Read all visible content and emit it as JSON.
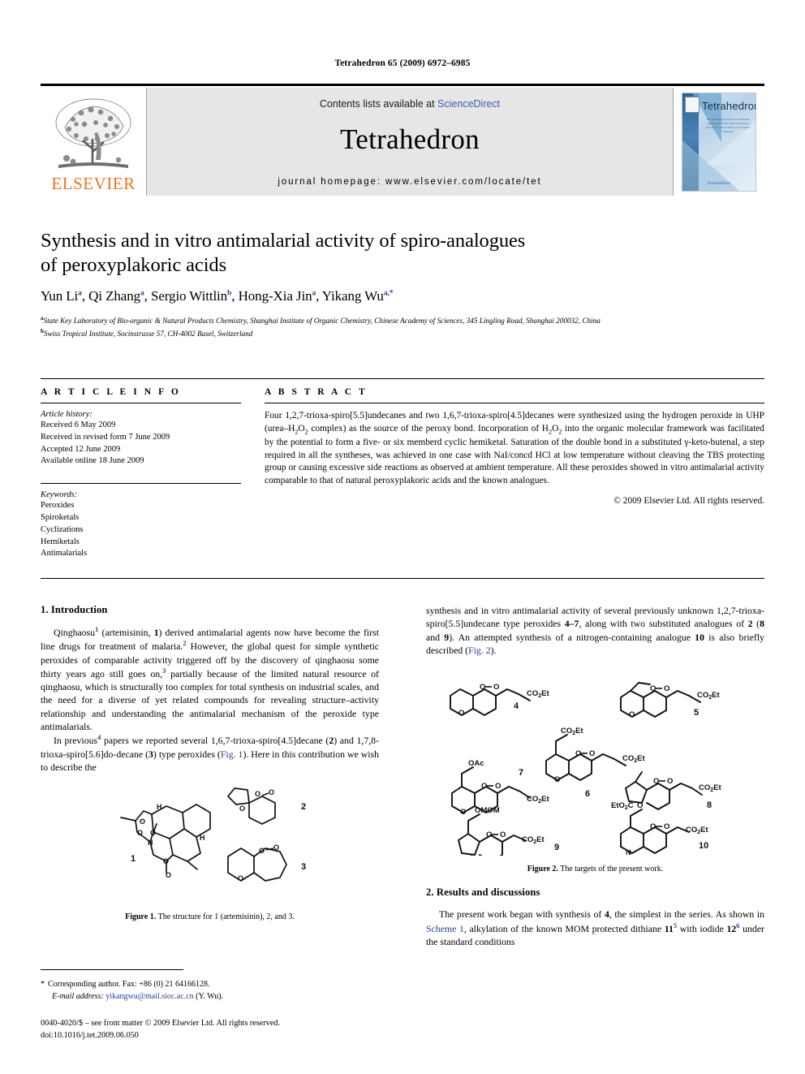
{
  "running_head": "Tetrahedron 65 (2009) 6972–6985",
  "masthead": {
    "contents_prefix": "Contents lists available at ",
    "sciencedirect": "ScienceDirect",
    "journal_name": "Tetrahedron",
    "homepage": "journal homepage: www.elsevier.com/locate/tet",
    "publisher_wordmark": "ELSEVIER",
    "cover_title": "Tetrahedron",
    "cover_subtitle": "The International Journal for the Rapid Publication of Full Original Research Papers and Critical Reviews in Organic Chemistry",
    "cover_footer": "ScienceDirect",
    "accent_orange": "#E87722",
    "link_blue": "#2b3d91",
    "masthead_grey": "#e6e6e6"
  },
  "title": "Synthesis and in vitro antimalarial activity of spiro-analogues of peroxyplakoric acids",
  "title_line1": "Synthesis and in vitro antimalarial activity of spiro-analogues",
  "title_line2": "of peroxyplakoric acids",
  "authors": [
    {
      "name": "Yun Li",
      "sup": "a"
    },
    {
      "name": "Qi Zhang",
      "sup": "a"
    },
    {
      "name": "Sergio Wittlin",
      "sup": "b"
    },
    {
      "name": "Hong-Xia Jin",
      "sup": "a"
    },
    {
      "name": "Yikang Wu",
      "sup": "a,*"
    }
  ],
  "affiliations": [
    {
      "sup": "a",
      "text": "State Key Laboratory of Bio-organic & Natural Products Chemistry, Shanghai Institute of Organic Chemistry, Chinese Academy of Sciences, 345 Lingling Road, Shanghai 200032, China"
    },
    {
      "sup": "b",
      "text": "Swiss Tropical Institute, Socinstrasse 57, CH-4002 Basel, Switzerland"
    }
  ],
  "article_info": {
    "heading": "A R T I C L E  I N F O",
    "history_title": "Article history:",
    "history": [
      "Received 6 May 2009",
      "Received in revised form 7 June 2009",
      "Accepted 12 June 2009",
      "Available online 18 June 2009"
    ],
    "keywords_title": "Keywords:",
    "keywords": [
      "Peroxides",
      "Spiroketals",
      "Cyclizations",
      "Hemiketals",
      "Antimalarials"
    ]
  },
  "abstract": {
    "heading": "A B S T R A C T",
    "text": "Four 1,2,7-trioxa-spiro[5.5]undecanes and two 1,6,7-trioxa-spiro[4.5]decanes were synthesized using the hydrogen peroxide in UHP (urea–H2O2 complex) as the source of the peroxy bond. Incorporation of H2O2 into the organic molecular framework was facilitated by the potential to form a five- or six memberd cyclic hemiketal. Saturation of the double bond in a substituted γ-keto-butenal, a step required in all the syntheses, was achieved in one case with NaI/concd HCl at low temperature without cleaving the TBS protecting group or causing excessive side reactions as observed at ambient temperature. All these peroxides showed in vitro antimalarial activity comparable to that of natural peroxyplakoric acids and the known analogues.",
    "copyright": "© 2009 Elsevier Ltd. All rights reserved."
  },
  "sections": {
    "introduction_heading": "1. Introduction",
    "intro_p1": "Qinghaosu1 (artemisinin, 1) derived antimalarial agents now have become the first line drugs for treatment of malaria.2 However, the global quest for simple synthetic peroxides of comparable activity triggered off by the discovery of qinghaosu some thirty years ago still goes on,3 partially because of the limited natural resource of qinghaosu, which is structurally too complex for total synthesis on industrial scales, and the need for a diverse of yet related compounds for revealing structure–activity relationship and understanding the antimalarial mechanism of the peroxide type antimalarials.",
    "intro_p2": "In previous4 papers we reported several 1,6,7-trioxa-spiro[4.5]decane (2) and 1,7,8-trioxa-spiro[5.6]do-decane (3) type peroxides (Fig. 1). Here in this contribution we wish to describe the synthesis and in vitro antimalarial activity of several previously unknown 1,2,7-trioxa-spiro[5.5]undecane type peroxides 4–7, along with two substituted analogues of 2 (8 and 9). An attempted synthesis of a nitrogen-containing analogue 10 is also briefly described (Fig. 2).",
    "results_heading": "2. Results and discussions",
    "results_p1": "The present work began with synthesis of 4, the simplest in the series. As shown in Scheme 1, alkylation of the known MOM protected dithiane 115 with iodide 126 under the standard conditions"
  },
  "figures": {
    "fig1_caption_bold": "Figure 1.",
    "fig1_caption_rest": " The structure for 1 (artemisinin), 2, and 3.",
    "fig1_labels": [
      "1",
      "2",
      "3"
    ],
    "fig2_caption_bold": "Figure 2.",
    "fig2_caption_rest": " The targets of the present work.",
    "fig2_labels": [
      "4",
      "5",
      "6",
      "7",
      "8",
      "9",
      "10"
    ],
    "fig2_groups": [
      "CO2Et",
      "OAc",
      "OMOM",
      "EtO2C",
      "O–O",
      "N",
      "H"
    ]
  },
  "footnote": {
    "star": "*",
    "corresponding": "Corresponding author. Fax: +86 (0) 21 64166128.",
    "email_label": "E-mail address:",
    "email": "yikangwu@mail.sioc.ac.cn",
    "email_owner": "(Y. Wu)."
  },
  "imprint": {
    "line1": "0040-4020/$ – see front matter © 2009 Elsevier Ltd. All rights reserved.",
    "line2": "doi:10.1016/j.tet.2009.06.050"
  }
}
